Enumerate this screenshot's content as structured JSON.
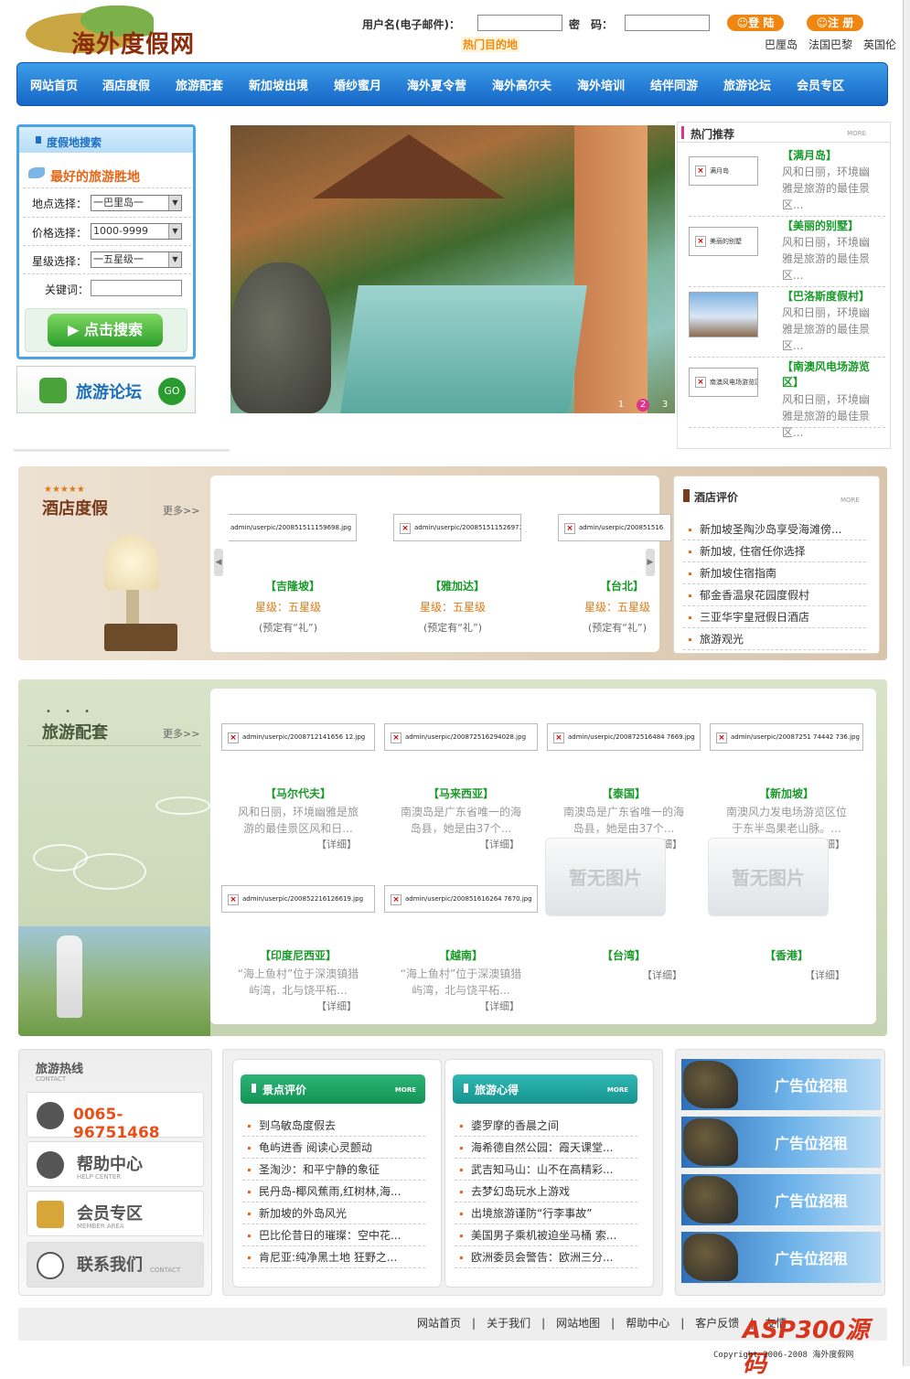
{
  "site": {
    "logo_text": "海外度假网"
  },
  "header": {
    "username_label": "用户名(电子邮件)：",
    "password_label": "密　码：",
    "login_label": "登 陆",
    "register_label": "注 册",
    "hot_destination_label": "热门目的地",
    "hot_destinations": "巴厘岛　法国巴黎　英国伦"
  },
  "nav": [
    "网站首页",
    "酒店度假",
    "旅游配套",
    "新加坡出境",
    "婚纱蜜月",
    "海外夏令营",
    "海外高尔夫",
    "海外培训",
    "结伴同游",
    "旅游论坛",
    "会员专区"
  ],
  "search": {
    "title": "度假地搜索",
    "subtitle": "最好的旅游胜地",
    "location_label": "地点选择：",
    "location_value": "一巴里岛一",
    "price_label": "价格选择：",
    "price_value": "1000-9999",
    "star_label": "星级选择：",
    "star_value": "一五星级一",
    "keyword_label": "关键词：",
    "button": "点击搜索"
  },
  "forum": {
    "label": "旅游论坛",
    "go": "GO"
  },
  "banner": {
    "pages": [
      "1",
      "2",
      "3"
    ],
    "active": "2"
  },
  "hot_rec": {
    "title": "热门推荐",
    "more": "MORE",
    "items": [
      {
        "title": "【满月岛】",
        "thumb": "满月岛",
        "desc": "风和日丽，环境幽雅是旅游的最佳景区..."
      },
      {
        "title": "【美丽的别墅】",
        "thumb": "美丽的别墅",
        "desc": "风和日丽，环境幽雅是旅游的最佳景区..."
      },
      {
        "title": "【巴洛斯度假村】",
        "thumb": "",
        "desc": "风和日丽，环境幽雅是旅游的最佳景区..."
      },
      {
        "title": "【南澳风电场游览区】",
        "thumb": "南澳风电场游览区",
        "desc": "风和日丽，环境幽雅是旅游的最佳景区..."
      }
    ]
  },
  "hotel": {
    "title": "酒店度假",
    "more": "更多>>",
    "items": [
      {
        "pic": "admin/userpic/200851511159698.jpg",
        "name": "【吉隆坡】",
        "star": "星级：五星级",
        "note": "(预定有“礼”)"
      },
      {
        "pic": "admin/userpic/200851511526973.jpg",
        "name": "【雅加达】",
        "star": "星级：五星级",
        "note": "(预定有“礼”)"
      },
      {
        "pic": "admin/userpic/200851516",
        "name": "【台北】",
        "star": "星级：五星级",
        "note": "(预定有“礼”)"
      }
    ]
  },
  "hotel_review": {
    "title": "酒店评价",
    "more": "MORE",
    "items": [
      "新加坡圣陶沙岛享受海滩傍...",
      "新加坡, 住宿任你选择",
      "新加坡住宿指南",
      "郁金香温泉花园度假村",
      "三亚华宇皇冠假日酒店",
      "旅游观光"
    ]
  },
  "tour": {
    "title": "旅游配套",
    "more": "更多>>",
    "detail": "【详细】",
    "no_image": "暂无图片",
    "items": [
      {
        "pic": "admin/userpic/2008712141656 12.jpg",
        "name": "【马尔代夫】",
        "desc": "风和日丽，环境幽雅是旅游的最佳景区风和日..."
      },
      {
        "pic": "admin/userpic/200872516294028.jpg",
        "name": "【马来西亚】",
        "desc": "南澳岛是广东省唯一的海岛县，她是由37个..."
      },
      {
        "pic": "admin/userpic/200872516484 7669.jpg",
        "name": "【泰国】",
        "desc": "南澳岛是广东省唯一的海岛县，她是由37个..."
      },
      {
        "pic": "admin/userpic/20087251 74442 736.jpg",
        "name": "【新加坡】",
        "desc": "南澳风力发电场游览区位于东半岛果老山脉。..."
      },
      {
        "pic": "admin/userpic/200852216126619.jpg",
        "name": "【印度尼西亚】",
        "desc": "“海上鱼村”位于深澳镇猎屿湾，北与饶平柘..."
      },
      {
        "pic": "admin/userpic/200851616264 7670.jpg",
        "name": "【越南】",
        "desc": "“海上鱼村”位于深澳镇猎屿湾，北与饶平柘..."
      },
      {
        "pic": "",
        "name": "【台湾】",
        "desc": ""
      },
      {
        "pic": "",
        "name": "【香港】",
        "desc": ""
      }
    ]
  },
  "hotline": {
    "title": "旅游热线",
    "sub": "CONTACT",
    "phone": "0065-96751468",
    "help": "帮助中心",
    "help_sub": "HELP CENTER",
    "member": "会员专区",
    "member_sub": "MEMBER AREA",
    "contact": "联系我们",
    "contact_sub": "CONTACT"
  },
  "scenic": {
    "title": "景点评价",
    "more": "MORE",
    "items": [
      "到乌敏岛度假去",
      "龟屿进香 阅读心灵颤动",
      "圣淘沙：和平宁静的象征",
      "民丹岛-椰风蕉雨,红树林,海...",
      "新加坡的外岛风光",
      "巴比伦昔日的璀璨：空中花...",
      "肯尼亚:纯净黑土地 狂野之..."
    ]
  },
  "experience": {
    "title": "旅游心得",
    "more": "MORE",
    "items": [
      "婆罗摩的香晨之间",
      "海希德自然公园：霞天课堂...",
      "武吉知马山：山不在高精彩...",
      "去梦幻岛玩水上游戏",
      "出境旅游谨防“行李事故”",
      "美国男子乘机被迫坐马桶 索...",
      "欧洲委员会警告：欧洲三分..."
    ]
  },
  "ads": [
    "广告位招租",
    "广告位招租",
    "广告位招租",
    "广告位招租"
  ],
  "footer": {
    "links": [
      "网站首页",
      "关于我们",
      "网站地图",
      "帮助中心",
      "客户反馈",
      "友情"
    ],
    "copyright": "Copyright 2006-2008 海外度假网",
    "watermark": "ASP300源码"
  }
}
